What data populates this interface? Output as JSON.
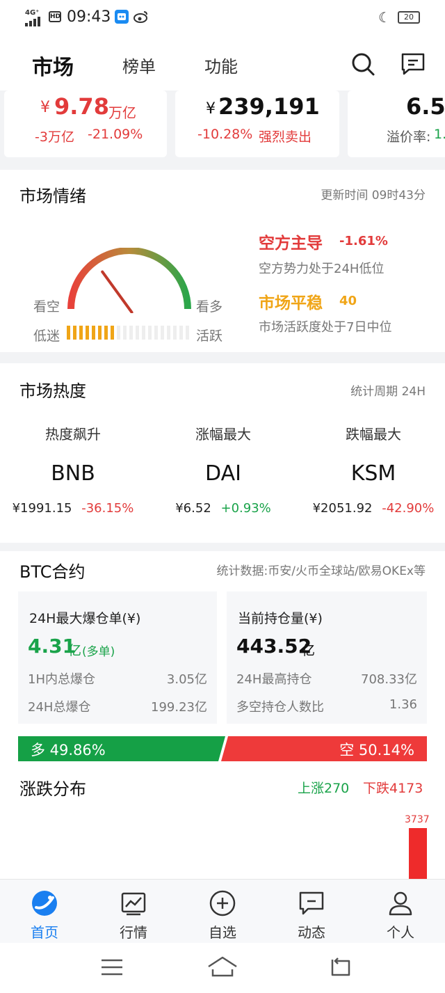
{
  "status_bar": {
    "network": "4G⁺",
    "hd": "HD",
    "time": "09:43",
    "battery": "20",
    "icons": [
      "signal-icon",
      "hd-icon",
      "app-icon",
      "weibo-icon",
      "moon-icon",
      "battery-icon"
    ]
  },
  "header": {
    "tabs": [
      "市场",
      "榜单",
      "功能"
    ],
    "active_tab": "市场",
    "icons": [
      "search-icon",
      "message-icon"
    ]
  },
  "summary": {
    "card1": {
      "currency": "¥",
      "value": "9.78",
      "unit": "万亿",
      "change": "-3万亿",
      "pct": "-21.09%"
    },
    "card2": {
      "currency": "¥",
      "value": "239,191",
      "pct": "-10.28%",
      "signal": "强烈卖出"
    },
    "card3": {
      "value": "6.5",
      "premium_label": "溢价率:",
      "premium_value": "1."
    }
  },
  "sentiment": {
    "title": "市场情绪",
    "update_time": "更新时间 09时43分",
    "left_label": "看空",
    "right_label": "看多",
    "low_label": "低迷",
    "high_label": "活跃",
    "bear_title": "空方主导",
    "bear_value": "-1.61%",
    "bear_desc": "空方势力处于24H低位",
    "activity_title": "市场平稳",
    "activity_value": "40",
    "activity_desc": "市场活跃度处于7日中位",
    "gauge_level": 0.3,
    "activity_level": 0.4
  },
  "heat": {
    "title": "市场热度",
    "period": "统计周期 24H",
    "columns": [
      {
        "label": "热度飙升",
        "symbol": "BNB",
        "price": "¥1991.15",
        "change": "-36.15%",
        "up": false
      },
      {
        "label": "涨幅最大",
        "symbol": "DAI",
        "price": "¥6.52",
        "change": "+0.93%",
        "up": true
      },
      {
        "label": "跌幅最大",
        "symbol": "KSM",
        "price": "¥2051.92",
        "change": "-42.90%",
        "up": false
      }
    ]
  },
  "btc": {
    "title": "BTC合约",
    "source": "统计数据:币安/火币全球站/欧易OKEx等",
    "left": {
      "title": "24H最大爆仓单(¥)",
      "value": "4.31",
      "unit": "亿",
      "tag": "(多单)",
      "rows": [
        {
          "label": "1H内总爆仓",
          "value": "3.05亿"
        },
        {
          "label": "24H总爆仓",
          "value": "199.23亿"
        }
      ]
    },
    "right": {
      "title": "当前持仓量(¥)",
      "value": "443.52",
      "unit": "亿",
      "rows": [
        {
          "label": "24H最高持仓",
          "value": "708.33亿"
        },
        {
          "label": "多空持仓人数比",
          "value": "1.36"
        }
      ]
    },
    "long_label": "多 49.86%",
    "short_label": "空 50.14%",
    "long_ratio": 0.4986
  },
  "distribution": {
    "title": "涨跌分布",
    "up": "上涨270",
    "down": "下跌4173",
    "bar_value": "3737"
  },
  "bottom_nav": [
    {
      "label": "首页",
      "icon": "home-icon",
      "active": true
    },
    {
      "label": "行情",
      "icon": "chart-icon",
      "active": false
    },
    {
      "label": "自选",
      "icon": "plus-circle-icon",
      "active": false
    },
    {
      "label": "动态",
      "icon": "message-icon",
      "active": false
    },
    {
      "label": "个人",
      "icon": "user-icon",
      "active": false
    }
  ],
  "colors": {
    "red": "#e23b3b",
    "green": "#1aa34a",
    "orange": "#f0a517",
    "blue": "#1a7ff0"
  }
}
